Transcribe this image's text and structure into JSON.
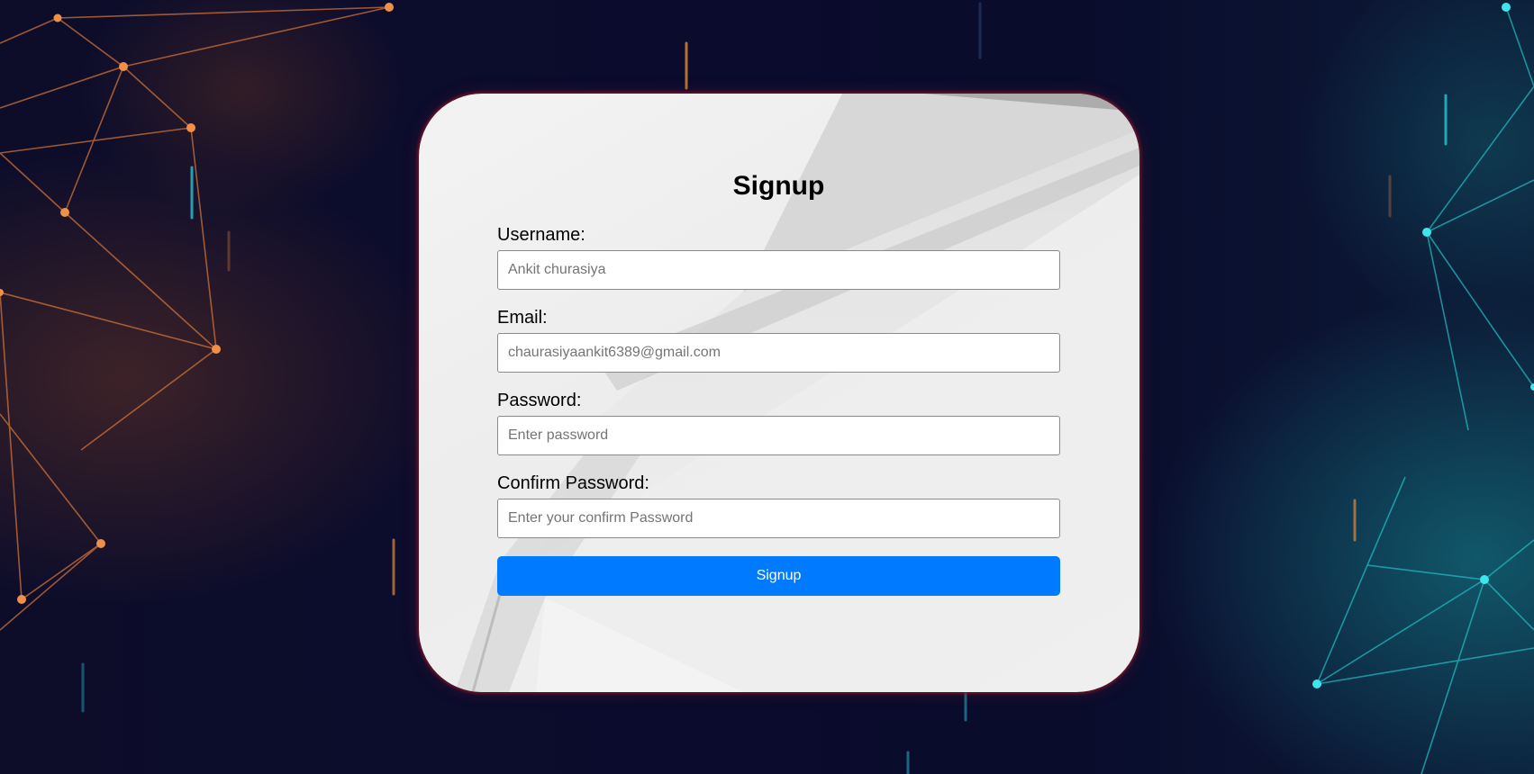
{
  "signup_form": {
    "title": "Signup",
    "fields": [
      {
        "label": "Username:",
        "placeholder": "Ankit churasiya",
        "value": ""
      },
      {
        "label": "Email:",
        "placeholder": "chaurasiyaankit6389@gmail.com",
        "value": ""
      },
      {
        "label": "Password:",
        "placeholder": "Enter password",
        "value": ""
      },
      {
        "label": "Confirm Password:",
        "placeholder": "Enter your confirm Password",
        "value": ""
      }
    ],
    "submit_label": "Signup"
  },
  "colors": {
    "button": "#007bff",
    "card": "#efefef",
    "background": "#0b0b2d",
    "accent_orange": "#e8823a",
    "accent_teal": "#1fd0d8"
  }
}
